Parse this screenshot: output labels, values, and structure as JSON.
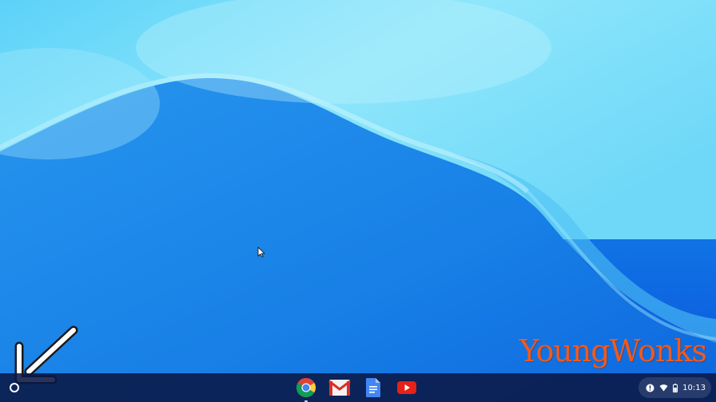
{
  "desktop": {
    "wallpaper": {
      "colors": {
        "deep": "#0a54db",
        "mid": "#1e8cf0",
        "light": "#8ee6fb",
        "highlight": "#c8f5fd"
      }
    },
    "watermark": {
      "text": "YoungWonks",
      "color": "#f05a1e"
    },
    "annotation": {
      "icon": "arrow-pointing-to-launcher-icon",
      "color": "#ffffff"
    },
    "cursor": {
      "icon": "mouse-pointer-icon"
    }
  },
  "shelf": {
    "launcher": {
      "icon": "launcher-circle-icon"
    },
    "apps": [
      {
        "name": "Chrome",
        "icon": "chrome-icon",
        "open": true
      },
      {
        "name": "Gmail",
        "icon": "gmail-icon",
        "open": false
      },
      {
        "name": "Docs",
        "icon": "docs-icon",
        "open": false
      },
      {
        "name": "YouTube",
        "icon": "youtube-icon",
        "open": false
      }
    ],
    "tray": {
      "notification_icon": "notification-alert-icon",
      "wifi_icon": "wifi-icon",
      "battery_icon": "battery-icon",
      "time": "10:13"
    }
  }
}
